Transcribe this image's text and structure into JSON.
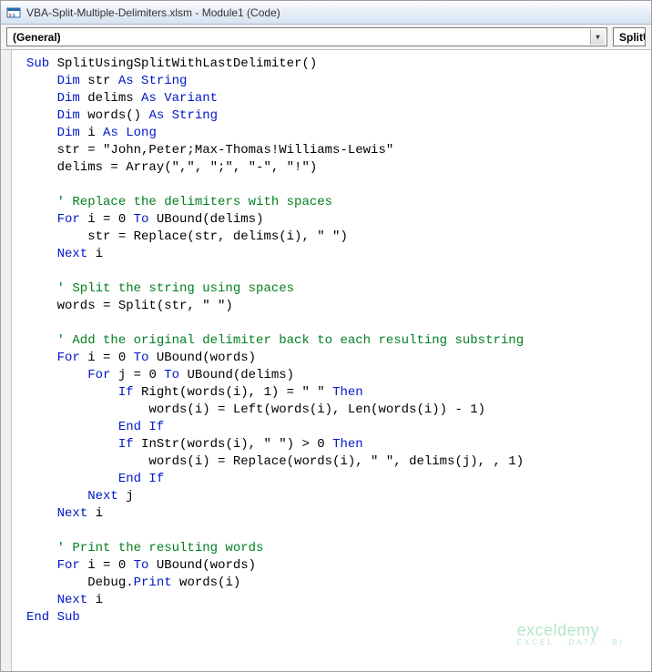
{
  "window": {
    "title": "VBA-Split-Multiple-Delimiters.xlsm - Module1 (Code)"
  },
  "toolbar": {
    "object_dropdown": "(General)",
    "proc_dropdown": "SplitU"
  },
  "code": {
    "l1a": "Sub",
    "l1b": " SplitUsingSplitWithLastDelimiter()",
    "l2a": "    ",
    "l2b": "Dim",
    "l2c": " str ",
    "l2d": "As String",
    "l3a": "    ",
    "l3b": "Dim",
    "l3c": " delims ",
    "l3d": "As Variant",
    "l4a": "    ",
    "l4b": "Dim",
    "l4c": " words() ",
    "l4d": "As String",
    "l5a": "    ",
    "l5b": "Dim",
    "l5c": " i ",
    "l5d": "As Long",
    "l6": "    str = \"John,Peter;Max-Thomas!Williams-Lewis\"",
    "l7": "    delims = Array(\",\", \";\", \"-\", \"!\")",
    "blank": "",
    "l8": "    ' Replace the delimiters with spaces",
    "l9a": "    ",
    "l9b": "For",
    "l9c": " i = 0 ",
    "l9d": "To",
    "l9e": " UBound(delims)",
    "l10": "        str = Replace(str, delims(i), \" \")",
    "l11a": "    ",
    "l11b": "Next",
    "l11c": " i",
    "l12": "    ' Split the string using spaces",
    "l13": "    words = Split(str, \" \")",
    "l14": "    ' Add the original delimiter back to each resulting substring",
    "l15a": "    ",
    "l15b": "For",
    "l15c": " i = 0 ",
    "l15d": "To",
    "l15e": " UBound(words)",
    "l16a": "        ",
    "l16b": "For",
    "l16c": " j = 0 ",
    "l16d": "To",
    "l16e": " UBound(delims)",
    "l17a": "            ",
    "l17b": "If",
    "l17c": " Right(words(i), 1) = \" \" ",
    "l17d": "Then",
    "l18": "                words(i) = Left(words(i), Len(words(i)) - 1)",
    "l19a": "            ",
    "l19b": "End If",
    "l20a": "            ",
    "l20b": "If",
    "l20c": " InStr(words(i), \" \") > 0 ",
    "l20d": "Then",
    "l21": "                words(i) = Replace(words(i), \" \", delims(j), , 1)",
    "l22a": "            ",
    "l22b": "End If",
    "l23a": "        ",
    "l23b": "Next",
    "l23c": " j",
    "l24a": "    ",
    "l24b": "Next",
    "l24c": " i",
    "l25": "    ' Print the resulting words",
    "l26a": "    ",
    "l26b": "For",
    "l26c": " i = 0 ",
    "l26d": "To",
    "l26e": " UBound(words)",
    "l27a": "        Debug.",
    "l27b": "Print",
    "l27c": " words(i)",
    "l28a": "    ",
    "l28b": "Next",
    "l28c": " i",
    "l29": "End Sub"
  },
  "watermark": {
    "main": "exceldemy",
    "sub": "EXCEL · DATA · BI"
  }
}
